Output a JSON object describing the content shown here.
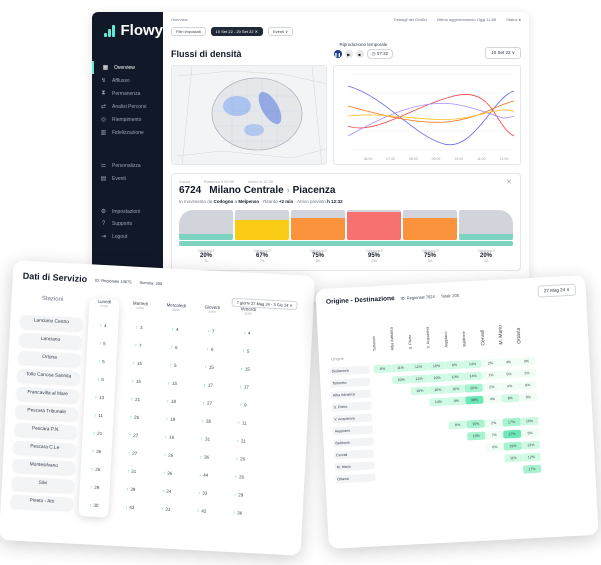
{
  "app": {
    "name": "Flowy"
  },
  "sidebar": {
    "items": [
      {
        "icon": "grid-icon",
        "glyph": "▦",
        "label": "Overview",
        "active": true
      },
      {
        "icon": "flow-icon",
        "glyph": "↯",
        "label": "Afflusso",
        "active": false
      },
      {
        "icon": "hourglass-icon",
        "glyph": "⧗",
        "label": "Permanenza",
        "active": false
      },
      {
        "icon": "route-icon",
        "glyph": "⇄",
        "label": "Analisi Percorsi",
        "active": false
      },
      {
        "icon": "target-icon",
        "glyph": "◎",
        "label": "Riempimento",
        "active": false
      },
      {
        "icon": "bars-icon",
        "glyph": "▥",
        "label": "Fidelizzazione",
        "active": false
      }
    ],
    "items2": [
      {
        "icon": "sliders-icon",
        "glyph": "⚌",
        "label": "Personalizza"
      },
      {
        "icon": "calendar-icon",
        "glyph": "▤",
        "label": "Eventi"
      }
    ],
    "items3": [
      {
        "icon": "gear-icon",
        "glyph": "⚙",
        "label": "Impostazioni"
      },
      {
        "icon": "help-icon",
        "glyph": "?",
        "label": "Supporto"
      },
      {
        "icon": "logout-icon",
        "glyph": "⇥",
        "label": "Logout"
      }
    ]
  },
  "topbar": {
    "crumb": "Overview",
    "right": [
      "Dettagli dei Grafici",
      "Ultimo aggiornamento Oggi 11:58",
      "Status ●"
    ]
  },
  "filters": {
    "save": "Filtri impostati",
    "date": "10 Set 22 - 20 Set 22  ✕",
    "events": "Eventi  ∨"
  },
  "flow": {
    "title": "Flussi di densità",
    "playback_label": "Riproduzione temporale",
    "time": "07:32",
    "date_select": "10 Set 22  ∨",
    "time_ticks": [
      "06:00",
      "07:00",
      "08:00",
      "09:00",
      "10:00",
      "11:00",
      "12:00"
    ]
  },
  "train": {
    "top_labels": [
      "Corsa",
      "Partenza h 09:00",
      "Arrivo h 12:30"
    ],
    "number": "6724",
    "from": "Milano Centrale",
    "to": "Piacenza",
    "info_prefix": "In movimento da",
    "info_from": "Codogno",
    "info_mid": "a",
    "info_to": "Melpenso",
    "delay_label": "Ritardo",
    "delay": "+2 min",
    "eta_label": "Arrivo previsto",
    "eta": "h 12:32",
    "wagons": [
      {
        "label": "Carrozza 1",
        "pct": "20%",
        "cnt": "11",
        "fill": 0.2,
        "color": "#7dd3c0"
      },
      {
        "label": "Carrozza 2",
        "pct": "67%",
        "cnt": "75",
        "fill": 0.67,
        "color": "#facc15"
      },
      {
        "label": "Carrozza 3",
        "pct": "75%",
        "cnt": "80",
        "fill": 0.75,
        "color": "#fb923c"
      },
      {
        "label": "Carrozza 4",
        "pct": "95%",
        "cnt": "230",
        "fill": 0.95,
        "color": "#f87171"
      },
      {
        "label": "Carrozza 5",
        "pct": "75%",
        "cnt": "60",
        "fill": 0.75,
        "color": "#fb923c"
      },
      {
        "label": "Carrozza 6",
        "pct": "20%",
        "cnt": "12",
        "fill": 0.2,
        "color": "#7dd3c0"
      }
    ]
  },
  "services": {
    "title": "Dati di Servizio",
    "id_label": "ID: Regionale 10875",
    "sum_label": "Somma: 200",
    "week": "7 giorni  27 Mag 24 - 3 Giu 24  ∨",
    "stations_header": "Stazioni",
    "stations": [
      "Lanciano Centro",
      "Lanciano",
      "Ortona",
      "Tollo Canosa Sannita",
      "Francavilla al Mare",
      "Pescara Tribunale",
      "Pescara P.N.",
      "Pescara C.Le",
      "Montesilvano",
      "Silvi",
      "Pineto - Atri"
    ],
    "days": [
      {
        "name": "Lunedì",
        "date": "27/05",
        "highlight": true,
        "cells": [
          "4",
          "5",
          "5",
          "5",
          "13",
          "11",
          "21",
          "36",
          "26",
          "29",
          "30"
        ]
      },
      {
        "name": "Martedì",
        "date": "28/05",
        "highlight": false,
        "cells": [
          "3",
          "7",
          "15",
          "15",
          "21",
          "25",
          "27",
          "27",
          "31",
          "39",
          "43"
        ]
      },
      {
        "name": "Mercoledì",
        "date": "29/05",
        "highlight": false,
        "cells": [
          "4",
          "6",
          "5",
          "15",
          "18",
          "19",
          "16",
          "26",
          "36",
          "24",
          "31"
        ]
      },
      {
        "name": "Giovedì",
        "date": "30/05",
        "highlight": false,
        "cells": [
          "7",
          "6",
          "15",
          "17",
          "27",
          "28",
          "31",
          "36",
          "44",
          "33",
          "42"
        ]
      },
      {
        "name": "Venerdì",
        "date": "31/05",
        "highlight": false,
        "cells": [
          "4",
          "5",
          "15",
          "17",
          "9",
          "11",
          "21",
          "26",
          "26",
          "29",
          "36"
        ]
      }
    ]
  },
  "od": {
    "title": "Origine - Destinazione",
    "id_label": "ID: Regionale 7624",
    "tot_label": "Totali: 200",
    "date": "27 Mag 24  ∨",
    "dest_label": "Destinazione",
    "origin_label": "Origine",
    "columns": [
      "Giulianova",
      "Tortoreto",
      "Alba Adriatica",
      "S. Pietro",
      "V. Acquaviva",
      "Aeppiano",
      "Baldrone",
      "Cervali",
      "M. Mario",
      "Ottavia"
    ],
    "rows": [
      {
        "name": "Giulianova",
        "cells": [
          "8%",
          "11%",
          "12%",
          "10%",
          "8%",
          "14%",
          "2%",
          "4%",
          "3%"
        ]
      },
      {
        "name": "Tortoreto",
        "cells": [
          "",
          "10%",
          "12%",
          "10%",
          "10%",
          "14%",
          "1%",
          "5%",
          "2%"
        ]
      },
      {
        "name": "Alba Adriatica",
        "cells": [
          "",
          "",
          "10%",
          "10%",
          "10%",
          "20%",
          "2%",
          "4%",
          "6%"
        ]
      },
      {
        "name": "S. Pietro",
        "cells": [
          "",
          "",
          "",
          "14%",
          "9%",
          "38%",
          "4%",
          "8%",
          "5%"
        ]
      },
      {
        "name": "V. Acquaviva",
        "cells": [
          "",
          "",
          "",
          "",
          "",
          "",
          "",
          "",
          ""
        ]
      },
      {
        "name": "Aeppiano",
        "cells": [
          "",
          "",
          "",
          "",
          "8%",
          "15%",
          "2%",
          "17%",
          "10%"
        ]
      },
      {
        "name": "Baldrone",
        "cells": [
          "",
          "",
          "",
          "",
          "",
          "15%",
          "7%",
          "27%",
          "5%"
        ]
      },
      {
        "name": "Cervali",
        "cells": [
          "",
          "",
          "",
          "",
          "",
          "",
          "6%",
          "19%",
          "13%"
        ]
      },
      {
        "name": "M. Mario",
        "cells": [
          "",
          "",
          "",
          "",
          "",
          "",
          "",
          "11%",
          "12%"
        ]
      },
      {
        "name": "Ottavia",
        "cells": [
          "",
          "",
          "",
          "",
          "",
          "",
          "",
          "",
          "17%"
        ]
      }
    ]
  }
}
